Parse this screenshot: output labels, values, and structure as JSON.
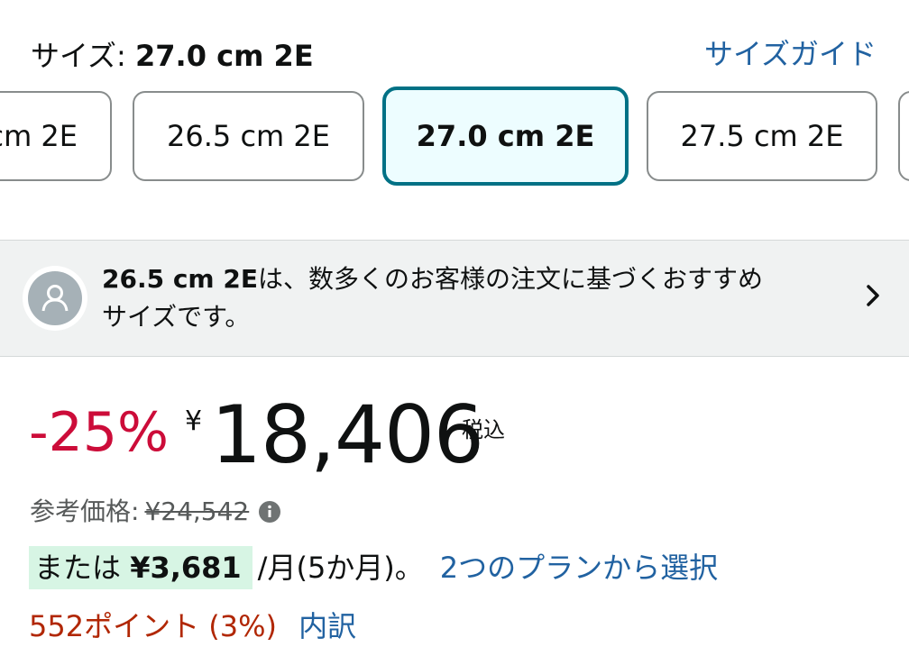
{
  "size": {
    "label": "サイズ:",
    "selected": "27.0 cm 2E",
    "guide_link": "サイズガイド",
    "options": [
      "cm 2E",
      "26.5 cm 2E",
      "27.0 cm 2E",
      "27.5 cm 2E",
      ""
    ]
  },
  "recommendation": {
    "size": "26.5 cm 2E",
    "text_part1": "は、数多くのお客様の注文に基づくおすすめ",
    "text_part2": "サイズです。"
  },
  "price": {
    "discount": "-25%",
    "currency": "¥",
    "amount": "18,406",
    "tax_note": "税込",
    "reference_label": "参考価格:",
    "reference_value": "¥24,542"
  },
  "installment": {
    "prefix": "または",
    "amount": "¥3,681",
    "per_month": "/月(5か月)。",
    "plan_link": "2つのプランから選択"
  },
  "points": {
    "text": "552ポイント (3%)",
    "breakdown_link": "内訳"
  },
  "colors": {
    "accent": "#007185",
    "link": "#2162a1",
    "discount": "#cc0c39",
    "points": "#b12704",
    "install_highlight": "#d7f5e4"
  },
  "icons": [
    "avatar-icon",
    "chevron-right-icon",
    "info-icon"
  ]
}
